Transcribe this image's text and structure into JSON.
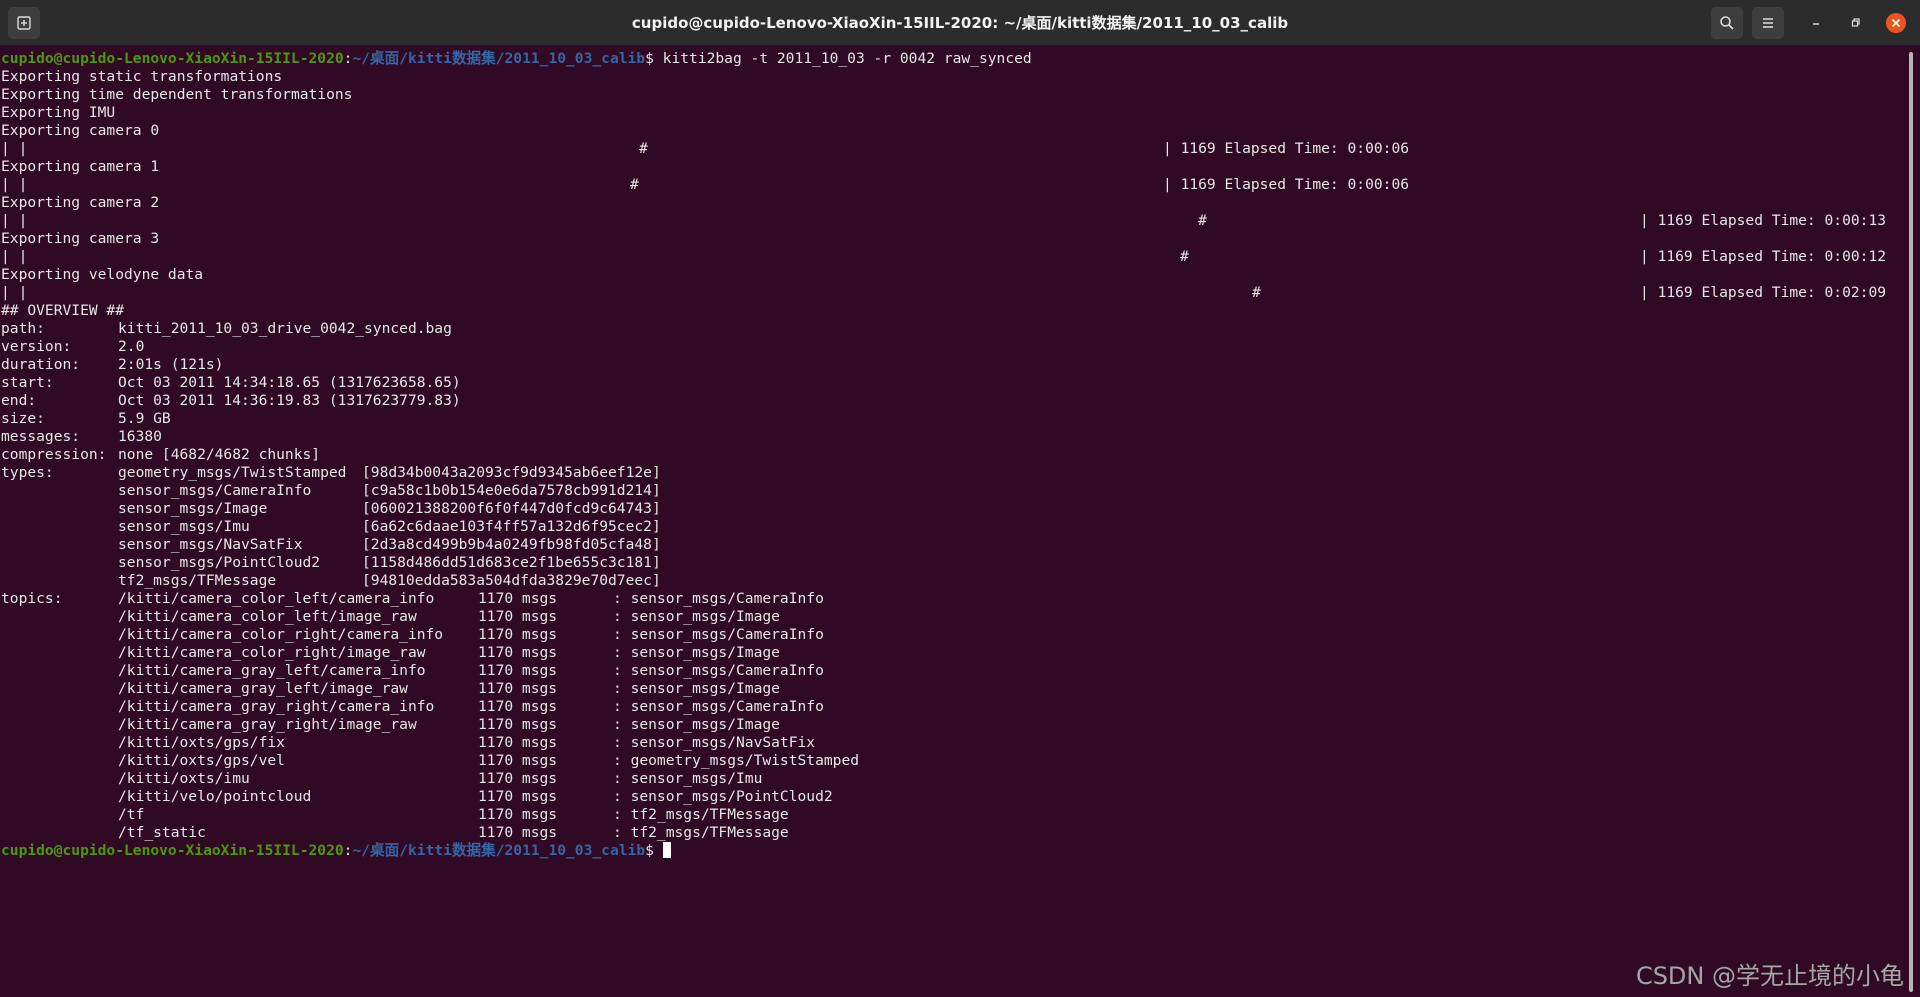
{
  "window": {
    "title": "cupido@cupido-Lenovo-XiaoXin-15IIL-2020: ~/桌面/kitti数据集/2011_10_03_calib",
    "icons": {
      "new_tab": "new-tab-icon",
      "search": "search-icon",
      "menu": "hamburger-menu-icon",
      "minimize": "minimize-icon",
      "maximize": "maximize-icon",
      "close": "close-icon"
    }
  },
  "prompt": {
    "user": "cupido@cupido-Lenovo-XiaoXin-15IIL-2020",
    "sep": ":",
    "path": "~/桌面/kitti数据集/2011_10_03_calib",
    "dollar": "$ ",
    "command": "kitti2bag -t 2011_10_03 -r 0042 raw_synced"
  },
  "export": {
    "static": "Exporting static transformations",
    "time": "Exporting time dependent transformations",
    "imu": "Exporting IMU",
    "cam0": "Exporting camera 0",
    "cam1": "Exporting camera 1",
    "cam2": "Exporting camera 2",
    "cam3": "Exporting camera 3",
    "velo": "Exporting velodyne data"
  },
  "progress": {
    "bar_start": "| |",
    "hash": "#",
    "cam0_end": "| 1169 Elapsed Time: 0:00:06",
    "cam1_end": "| 1169 Elapsed Time: 0:00:06",
    "cam2_end": "| 1169 Elapsed Time: 0:00:13",
    "cam3_end": "| 1169 Elapsed Time: 0:00:12",
    "velo_end": "| 1169 Elapsed Time: 0:02:09"
  },
  "overview": {
    "header": "## OVERVIEW ##",
    "path_key": "path:",
    "path_val": "kitti_2011_10_03_drive_0042_synced.bag",
    "version_key": "version:",
    "version_val": "2.0",
    "duration_key": "duration:",
    "duration_val": "2:01s (121s)",
    "start_key": "start:",
    "start_val": "Oct 03 2011 14:34:18.65 (1317623658.65)",
    "end_key": "end:",
    "end_val": "Oct 03 2011 14:36:19.83 (1317623779.83)",
    "size_key": "size:",
    "size_val": "5.9 GB",
    "messages_key": "messages:",
    "messages_val": "16380",
    "compression_key": "compression:",
    "compression_val": "none [4682/4682 chunks]",
    "types_key": "types:",
    "types": [
      {
        "name": "geometry_msgs/TwistStamped",
        "hash": "[98d34b0043a2093cf9d9345ab6eef12e]"
      },
      {
        "name": "sensor_msgs/CameraInfo",
        "hash": "[c9a58c1b0b154e0e6da7578cb991d214]"
      },
      {
        "name": "sensor_msgs/Image",
        "hash": "[060021388200f6f0f447d0fcd9c64743]"
      },
      {
        "name": "sensor_msgs/Imu",
        "hash": "[6a62c6daae103f4ff57a132d6f95cec2]"
      },
      {
        "name": "sensor_msgs/NavSatFix",
        "hash": "[2d3a8cd499b9b4a0249fb98fd05cfa48]"
      },
      {
        "name": "sensor_msgs/PointCloud2",
        "hash": "[1158d486dd51d683ce2f1be655c3c181]"
      },
      {
        "name": "tf2_msgs/TFMessage",
        "hash": "[94810edda583a504dfda3829e70d7eec]"
      }
    ],
    "topics_key": "topics:",
    "topics": [
      {
        "name": "/kitti/camera_color_left/camera_info",
        "count": "1170 msgs",
        "type": ": sensor_msgs/CameraInfo"
      },
      {
        "name": "/kitti/camera_color_left/image_raw",
        "count": "1170 msgs",
        "type": ": sensor_msgs/Image"
      },
      {
        "name": "/kitti/camera_color_right/camera_info",
        "count": "1170 msgs",
        "type": ": sensor_msgs/CameraInfo"
      },
      {
        "name": "/kitti/camera_color_right/image_raw",
        "count": "1170 msgs",
        "type": ": sensor_msgs/Image"
      },
      {
        "name": "/kitti/camera_gray_left/camera_info",
        "count": "1170 msgs",
        "type": ": sensor_msgs/CameraInfo"
      },
      {
        "name": "/kitti/camera_gray_left/image_raw",
        "count": "1170 msgs",
        "type": ": sensor_msgs/Image"
      },
      {
        "name": "/kitti/camera_gray_right/camera_info",
        "count": "1170 msgs",
        "type": ": sensor_msgs/CameraInfo"
      },
      {
        "name": "/kitti/camera_gray_right/image_raw",
        "count": "1170 msgs",
        "type": ": sensor_msgs/Image"
      },
      {
        "name": "/kitti/oxts/gps/fix",
        "count": "1170 msgs",
        "type": ": sensor_msgs/NavSatFix"
      },
      {
        "name": "/kitti/oxts/gps/vel",
        "count": "1170 msgs",
        "type": ": geometry_msgs/TwistStamped"
      },
      {
        "name": "/kitti/oxts/imu",
        "count": "1170 msgs",
        "type": ": sensor_msgs/Imu"
      },
      {
        "name": "/kitti/velo/pointcloud",
        "count": "1170 msgs",
        "type": ": sensor_msgs/PointCloud2"
      },
      {
        "name": "/tf",
        "count": "1170 msgs",
        "type": ": tf2_msgs/TFMessage"
      },
      {
        "name": "/tf_static",
        "count": "1170 msgs",
        "type": ": tf2_msgs/TFMessage"
      }
    ]
  },
  "watermark": "CSDN @学无止境的小龟",
  "colors": {
    "background": "#300a24",
    "prompt_user": "#4e9a06",
    "prompt_path": "#3465a4",
    "text": "#e6e6e6",
    "close_button": "#e95420"
  }
}
